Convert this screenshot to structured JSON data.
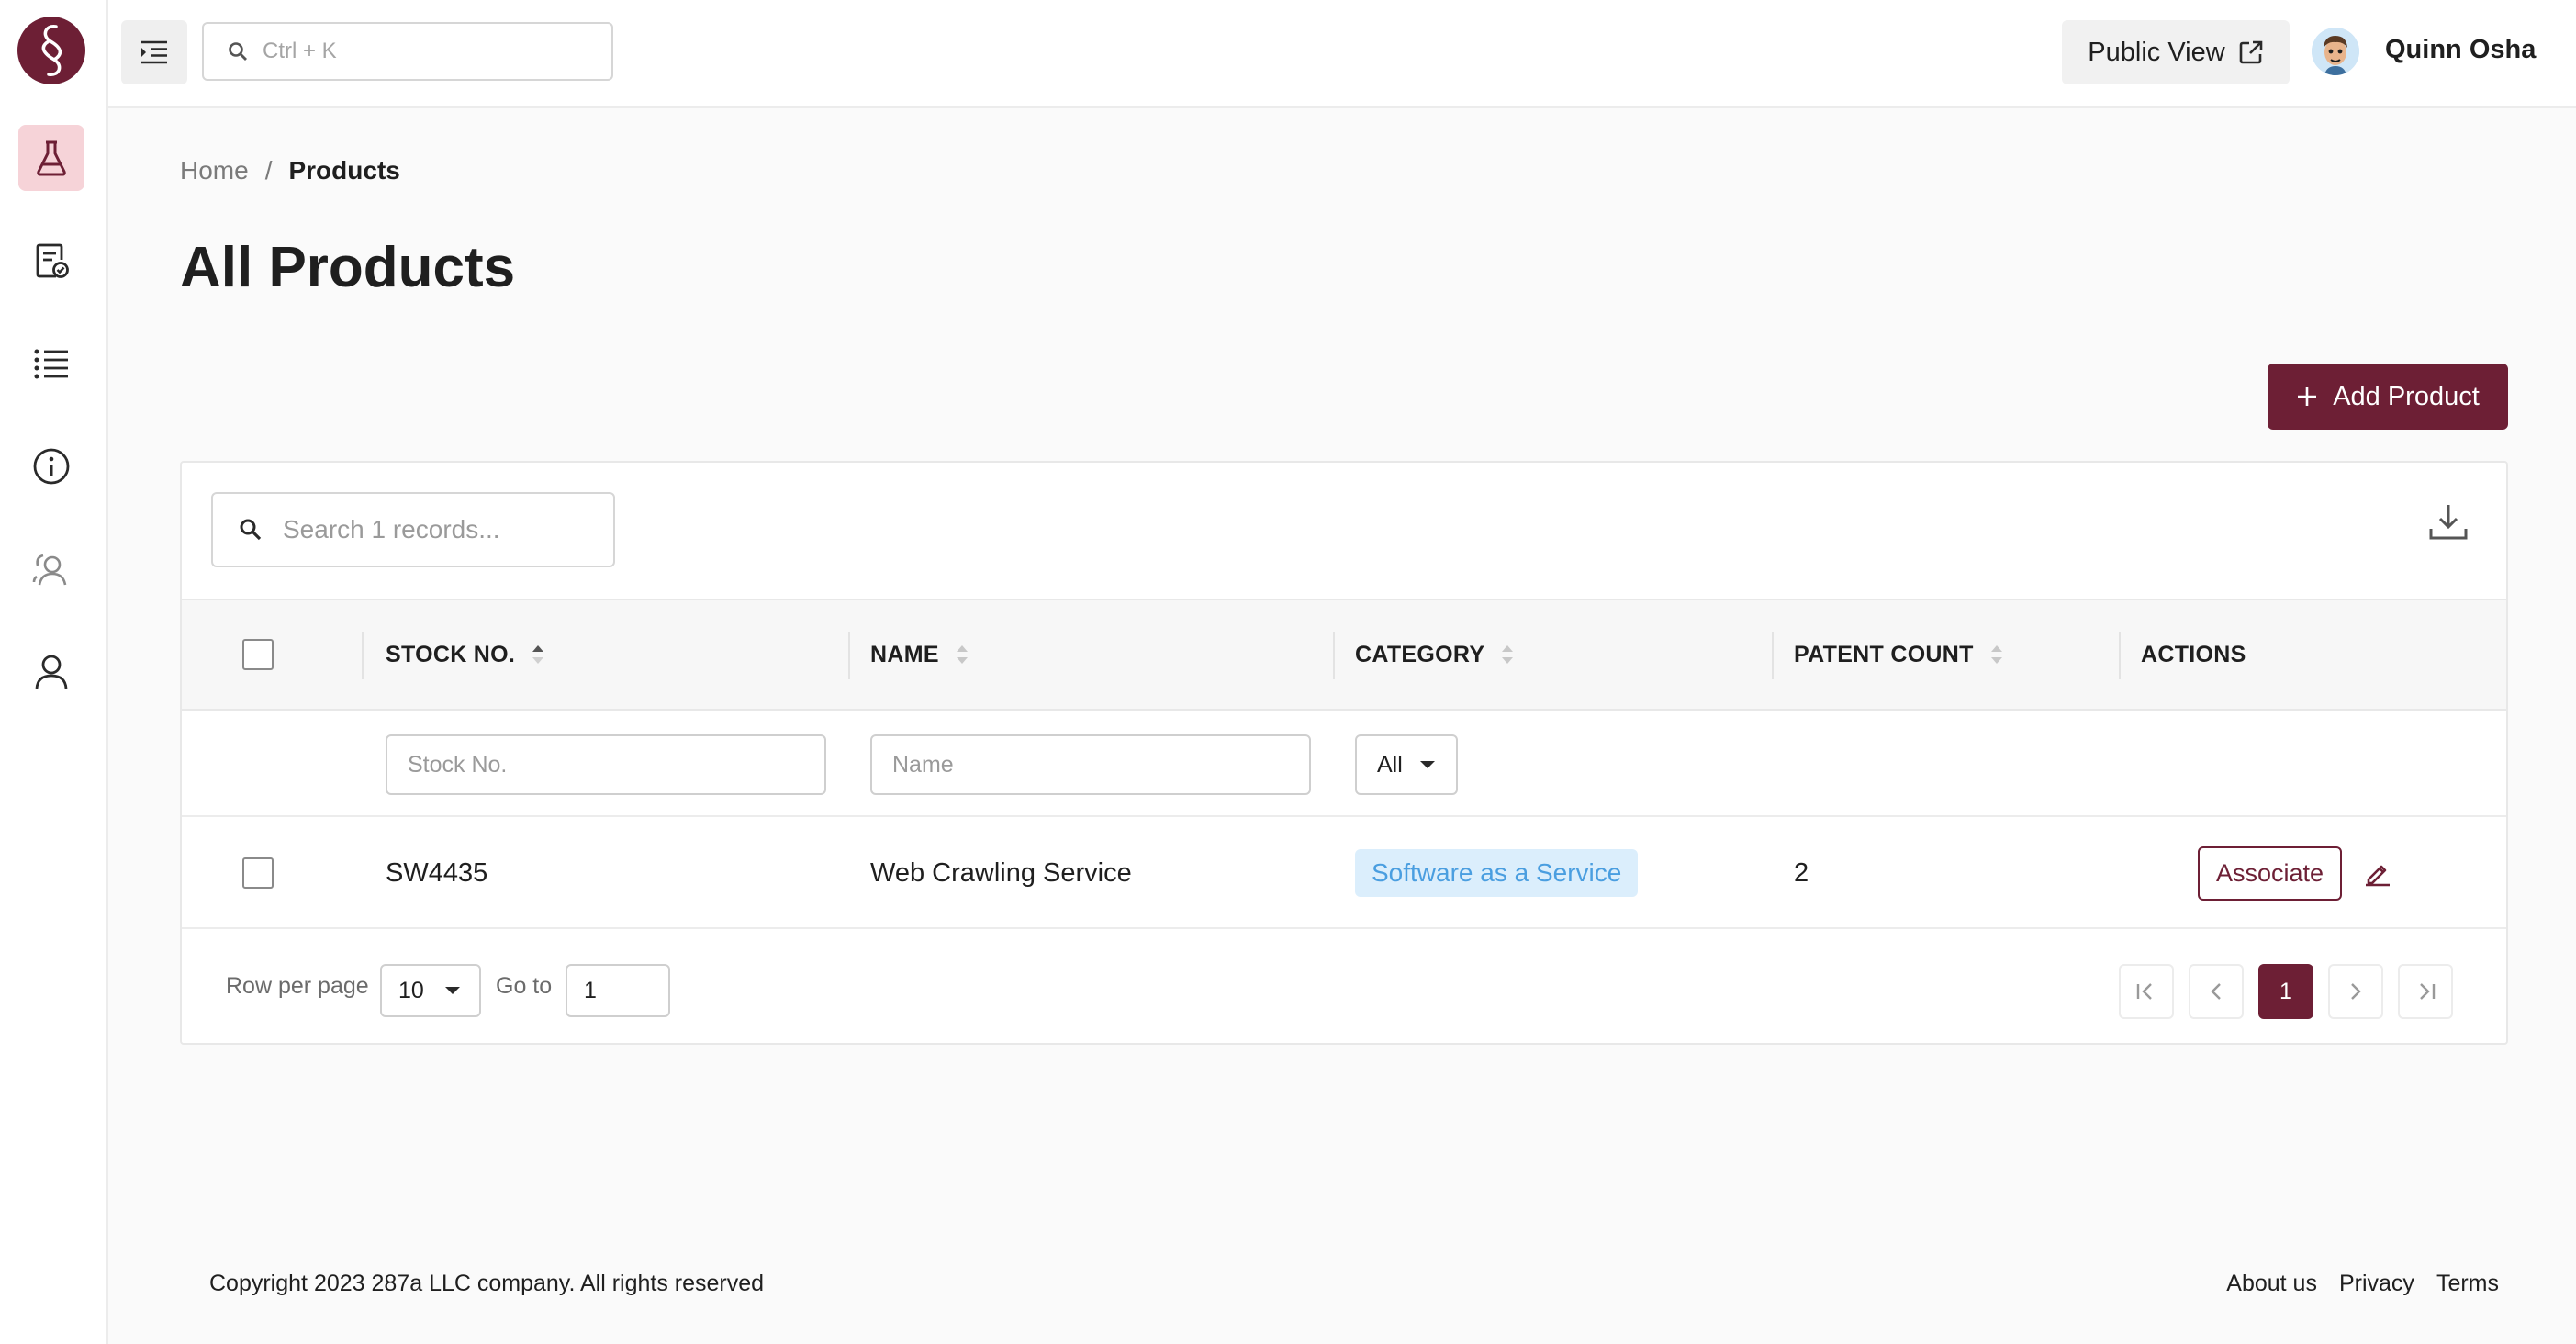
{
  "header": {
    "search_placeholder": "Ctrl + K",
    "public_view_label": "Public View",
    "user_name": "Quinn Osha"
  },
  "sidebar": {
    "items": [
      {
        "icon": "flask-icon",
        "active": true
      },
      {
        "icon": "certificate-document-icon",
        "active": false
      },
      {
        "icon": "list-icon",
        "active": false
      },
      {
        "icon": "info-icon",
        "active": false
      },
      {
        "icon": "users-icon",
        "active": false
      },
      {
        "icon": "user-icon",
        "active": false
      }
    ]
  },
  "breadcrumb": {
    "home": "Home",
    "separator": "/",
    "current": "Products"
  },
  "page": {
    "title": "All Products",
    "add_button_label": "Add Product"
  },
  "table": {
    "search_placeholder": "Search 1 records...",
    "columns": {
      "stock_no": "STOCK NO.",
      "name": "NAME",
      "category": "CATEGORY",
      "patent_count": "PATENT COUNT",
      "actions": "ACTIONS"
    },
    "filters": {
      "stock_no_placeholder": "Stock No.",
      "name_placeholder": "Name",
      "category_value": "All"
    },
    "rows": [
      {
        "stock_no": "SW4435",
        "name": "Web Crawling Service",
        "category": "Software as a Service",
        "patent_count": "2",
        "action_label": "Associate"
      }
    ],
    "pagination": {
      "rows_per_page_label": "Row per page",
      "rows_per_page_value": "10",
      "go_to_label": "Go to",
      "go_to_value": "1",
      "current_page": "1"
    }
  },
  "footer": {
    "copyright": "Copyright 2023 287a LLC company. All rights reserved",
    "links": [
      "About us",
      "Privacy",
      "Terms"
    ]
  },
  "colors": {
    "brand": "#6d1f35",
    "active_nav_bg": "#f6d3d8",
    "badge_bg": "#dbeefc",
    "badge_text": "#4a9ee0"
  }
}
